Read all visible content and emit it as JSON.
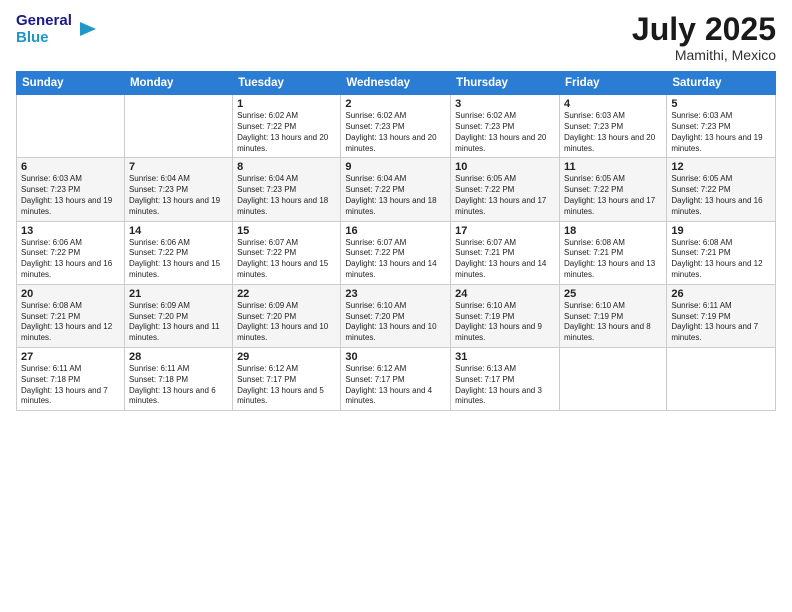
{
  "header": {
    "logo_line1": "General",
    "logo_line2": "Blue",
    "month": "July 2025",
    "location": "Mamithi, Mexico"
  },
  "days_of_week": [
    "Sunday",
    "Monday",
    "Tuesday",
    "Wednesday",
    "Thursday",
    "Friday",
    "Saturday"
  ],
  "weeks": [
    [
      {
        "num": "",
        "info": ""
      },
      {
        "num": "",
        "info": ""
      },
      {
        "num": "1",
        "info": "Sunrise: 6:02 AM\nSunset: 7:22 PM\nDaylight: 13 hours and 20 minutes."
      },
      {
        "num": "2",
        "info": "Sunrise: 6:02 AM\nSunset: 7:23 PM\nDaylight: 13 hours and 20 minutes."
      },
      {
        "num": "3",
        "info": "Sunrise: 6:02 AM\nSunset: 7:23 PM\nDaylight: 13 hours and 20 minutes."
      },
      {
        "num": "4",
        "info": "Sunrise: 6:03 AM\nSunset: 7:23 PM\nDaylight: 13 hours and 20 minutes."
      },
      {
        "num": "5",
        "info": "Sunrise: 6:03 AM\nSunset: 7:23 PM\nDaylight: 13 hours and 19 minutes."
      }
    ],
    [
      {
        "num": "6",
        "info": "Sunrise: 6:03 AM\nSunset: 7:23 PM\nDaylight: 13 hours and 19 minutes."
      },
      {
        "num": "7",
        "info": "Sunrise: 6:04 AM\nSunset: 7:23 PM\nDaylight: 13 hours and 19 minutes."
      },
      {
        "num": "8",
        "info": "Sunrise: 6:04 AM\nSunset: 7:23 PM\nDaylight: 13 hours and 18 minutes."
      },
      {
        "num": "9",
        "info": "Sunrise: 6:04 AM\nSunset: 7:22 PM\nDaylight: 13 hours and 18 minutes."
      },
      {
        "num": "10",
        "info": "Sunrise: 6:05 AM\nSunset: 7:22 PM\nDaylight: 13 hours and 17 minutes."
      },
      {
        "num": "11",
        "info": "Sunrise: 6:05 AM\nSunset: 7:22 PM\nDaylight: 13 hours and 17 minutes."
      },
      {
        "num": "12",
        "info": "Sunrise: 6:05 AM\nSunset: 7:22 PM\nDaylight: 13 hours and 16 minutes."
      }
    ],
    [
      {
        "num": "13",
        "info": "Sunrise: 6:06 AM\nSunset: 7:22 PM\nDaylight: 13 hours and 16 minutes."
      },
      {
        "num": "14",
        "info": "Sunrise: 6:06 AM\nSunset: 7:22 PM\nDaylight: 13 hours and 15 minutes."
      },
      {
        "num": "15",
        "info": "Sunrise: 6:07 AM\nSunset: 7:22 PM\nDaylight: 13 hours and 15 minutes."
      },
      {
        "num": "16",
        "info": "Sunrise: 6:07 AM\nSunset: 7:22 PM\nDaylight: 13 hours and 14 minutes."
      },
      {
        "num": "17",
        "info": "Sunrise: 6:07 AM\nSunset: 7:21 PM\nDaylight: 13 hours and 14 minutes."
      },
      {
        "num": "18",
        "info": "Sunrise: 6:08 AM\nSunset: 7:21 PM\nDaylight: 13 hours and 13 minutes."
      },
      {
        "num": "19",
        "info": "Sunrise: 6:08 AM\nSunset: 7:21 PM\nDaylight: 13 hours and 12 minutes."
      }
    ],
    [
      {
        "num": "20",
        "info": "Sunrise: 6:08 AM\nSunset: 7:21 PM\nDaylight: 13 hours and 12 minutes."
      },
      {
        "num": "21",
        "info": "Sunrise: 6:09 AM\nSunset: 7:20 PM\nDaylight: 13 hours and 11 minutes."
      },
      {
        "num": "22",
        "info": "Sunrise: 6:09 AM\nSunset: 7:20 PM\nDaylight: 13 hours and 10 minutes."
      },
      {
        "num": "23",
        "info": "Sunrise: 6:10 AM\nSunset: 7:20 PM\nDaylight: 13 hours and 10 minutes."
      },
      {
        "num": "24",
        "info": "Sunrise: 6:10 AM\nSunset: 7:19 PM\nDaylight: 13 hours and 9 minutes."
      },
      {
        "num": "25",
        "info": "Sunrise: 6:10 AM\nSunset: 7:19 PM\nDaylight: 13 hours and 8 minutes."
      },
      {
        "num": "26",
        "info": "Sunrise: 6:11 AM\nSunset: 7:19 PM\nDaylight: 13 hours and 7 minutes."
      }
    ],
    [
      {
        "num": "27",
        "info": "Sunrise: 6:11 AM\nSunset: 7:18 PM\nDaylight: 13 hours and 7 minutes."
      },
      {
        "num": "28",
        "info": "Sunrise: 6:11 AM\nSunset: 7:18 PM\nDaylight: 13 hours and 6 minutes."
      },
      {
        "num": "29",
        "info": "Sunrise: 6:12 AM\nSunset: 7:17 PM\nDaylight: 13 hours and 5 minutes."
      },
      {
        "num": "30",
        "info": "Sunrise: 6:12 AM\nSunset: 7:17 PM\nDaylight: 13 hours and 4 minutes."
      },
      {
        "num": "31",
        "info": "Sunrise: 6:13 AM\nSunset: 7:17 PM\nDaylight: 13 hours and 3 minutes."
      },
      {
        "num": "",
        "info": ""
      },
      {
        "num": "",
        "info": ""
      }
    ]
  ]
}
